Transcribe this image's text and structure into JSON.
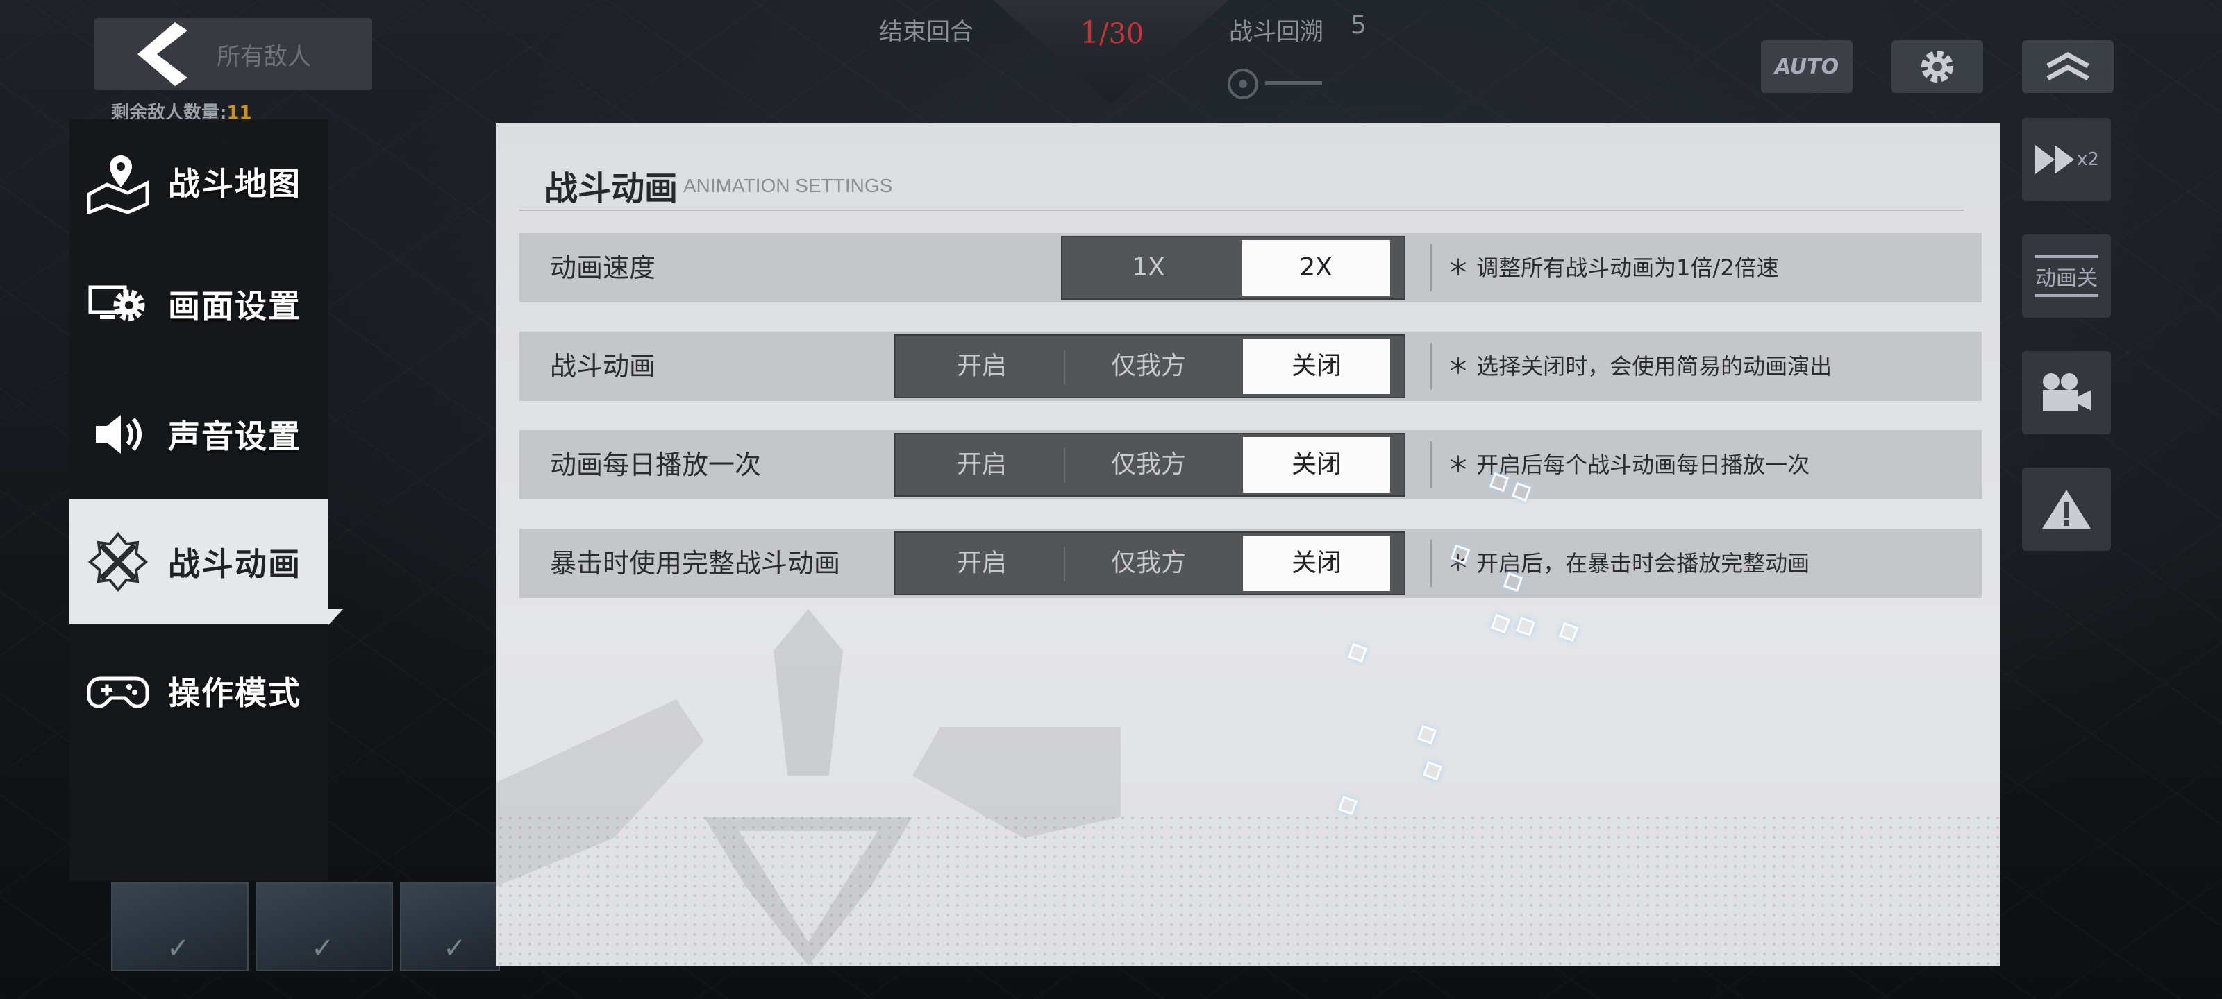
{
  "hud": {
    "back_ghost_text": "所有敌人",
    "enemy_remaining_label": "剩余敌人数量:",
    "enemy_remaining_count": "11",
    "turn_end": "结束回合",
    "turn_current": "1",
    "turn_total": "30",
    "rewind_label": "战斗回溯",
    "rewind_count": "5",
    "auto_label": "AUTO",
    "speed_badge": "x2",
    "anim_toggle_label": "动画关"
  },
  "menu": {
    "items": [
      {
        "label": "战斗地图",
        "icon": "map-pin-icon"
      },
      {
        "label": "画面设置",
        "icon": "display-gear-icon"
      },
      {
        "label": "声音设置",
        "icon": "speaker-icon"
      },
      {
        "label": "战斗动画",
        "icon": "crossed-swords-icon"
      },
      {
        "label": "操作模式",
        "icon": "gamepad-icon"
      }
    ],
    "active_index": 3
  },
  "panel": {
    "title": "战斗动画",
    "subtitle": "ANIMATION SETTINGS",
    "rows": [
      {
        "name": "动画速度",
        "options": [
          "1X",
          "2X"
        ],
        "selected": "2X",
        "note": "＊ 调整所有战斗动画为1倍/2倍速"
      },
      {
        "name": "战斗动画",
        "options": [
          "开启",
          "仅我方",
          "关闭"
        ],
        "selected": "关闭",
        "note": "＊ 选择关闭时，会使用简易的动画演出"
      },
      {
        "name": "动画每日播放一次",
        "options": [
          "开启",
          "仅我方",
          "关闭"
        ],
        "selected": "关闭",
        "note": "＊ 开启后每个战斗动画每日播放一次"
      },
      {
        "name": "暴击时使用完整战斗动画",
        "options": [
          "开启",
          "仅我方",
          "关闭"
        ],
        "selected": "关闭",
        "note": "＊ 开启后，在暴击时会播放完整动画"
      }
    ]
  },
  "colors": {
    "accent_red": "#c8343a",
    "panel_bg": "#e0e1e3",
    "row_bg": "#c5c6c9",
    "segment_bg": "#545557",
    "selected_bg": "#fbfbfb",
    "menu_bg": "#16181b",
    "menu_active_bg": "#e6e7e9"
  }
}
